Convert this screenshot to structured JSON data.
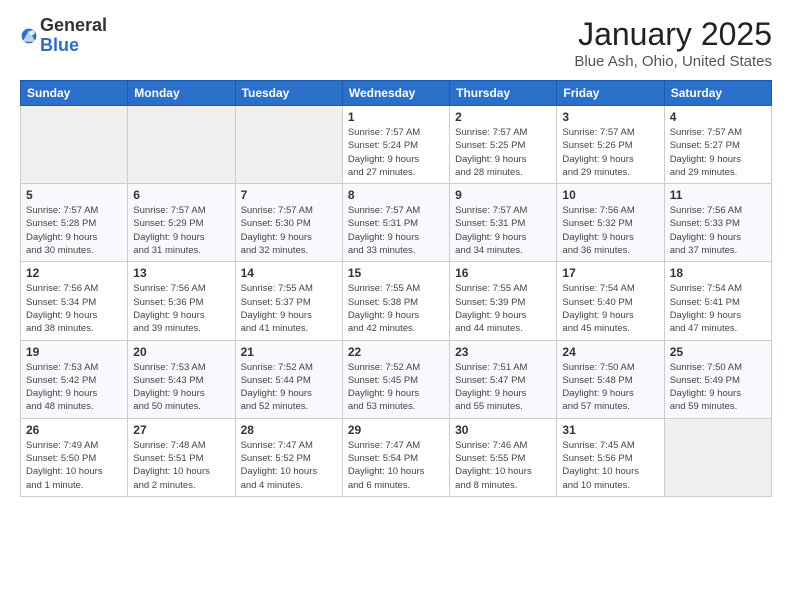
{
  "logo": {
    "general": "General",
    "blue": "Blue"
  },
  "header": {
    "title": "January 2025",
    "subtitle": "Blue Ash, Ohio, United States"
  },
  "weekdays": [
    "Sunday",
    "Monday",
    "Tuesday",
    "Wednesday",
    "Thursday",
    "Friday",
    "Saturday"
  ],
  "weeks": [
    [
      {
        "day": "",
        "info": ""
      },
      {
        "day": "",
        "info": ""
      },
      {
        "day": "",
        "info": ""
      },
      {
        "day": "1",
        "info": "Sunrise: 7:57 AM\nSunset: 5:24 PM\nDaylight: 9 hours\nand 27 minutes."
      },
      {
        "day": "2",
        "info": "Sunrise: 7:57 AM\nSunset: 5:25 PM\nDaylight: 9 hours\nand 28 minutes."
      },
      {
        "day": "3",
        "info": "Sunrise: 7:57 AM\nSunset: 5:26 PM\nDaylight: 9 hours\nand 29 minutes."
      },
      {
        "day": "4",
        "info": "Sunrise: 7:57 AM\nSunset: 5:27 PM\nDaylight: 9 hours\nand 29 minutes."
      }
    ],
    [
      {
        "day": "5",
        "info": "Sunrise: 7:57 AM\nSunset: 5:28 PM\nDaylight: 9 hours\nand 30 minutes."
      },
      {
        "day": "6",
        "info": "Sunrise: 7:57 AM\nSunset: 5:29 PM\nDaylight: 9 hours\nand 31 minutes."
      },
      {
        "day": "7",
        "info": "Sunrise: 7:57 AM\nSunset: 5:30 PM\nDaylight: 9 hours\nand 32 minutes."
      },
      {
        "day": "8",
        "info": "Sunrise: 7:57 AM\nSunset: 5:31 PM\nDaylight: 9 hours\nand 33 minutes."
      },
      {
        "day": "9",
        "info": "Sunrise: 7:57 AM\nSunset: 5:31 PM\nDaylight: 9 hours\nand 34 minutes."
      },
      {
        "day": "10",
        "info": "Sunrise: 7:56 AM\nSunset: 5:32 PM\nDaylight: 9 hours\nand 36 minutes."
      },
      {
        "day": "11",
        "info": "Sunrise: 7:56 AM\nSunset: 5:33 PM\nDaylight: 9 hours\nand 37 minutes."
      }
    ],
    [
      {
        "day": "12",
        "info": "Sunrise: 7:56 AM\nSunset: 5:34 PM\nDaylight: 9 hours\nand 38 minutes."
      },
      {
        "day": "13",
        "info": "Sunrise: 7:56 AM\nSunset: 5:36 PM\nDaylight: 9 hours\nand 39 minutes."
      },
      {
        "day": "14",
        "info": "Sunrise: 7:55 AM\nSunset: 5:37 PM\nDaylight: 9 hours\nand 41 minutes."
      },
      {
        "day": "15",
        "info": "Sunrise: 7:55 AM\nSunset: 5:38 PM\nDaylight: 9 hours\nand 42 minutes."
      },
      {
        "day": "16",
        "info": "Sunrise: 7:55 AM\nSunset: 5:39 PM\nDaylight: 9 hours\nand 44 minutes."
      },
      {
        "day": "17",
        "info": "Sunrise: 7:54 AM\nSunset: 5:40 PM\nDaylight: 9 hours\nand 45 minutes."
      },
      {
        "day": "18",
        "info": "Sunrise: 7:54 AM\nSunset: 5:41 PM\nDaylight: 9 hours\nand 47 minutes."
      }
    ],
    [
      {
        "day": "19",
        "info": "Sunrise: 7:53 AM\nSunset: 5:42 PM\nDaylight: 9 hours\nand 48 minutes."
      },
      {
        "day": "20",
        "info": "Sunrise: 7:53 AM\nSunset: 5:43 PM\nDaylight: 9 hours\nand 50 minutes."
      },
      {
        "day": "21",
        "info": "Sunrise: 7:52 AM\nSunset: 5:44 PM\nDaylight: 9 hours\nand 52 minutes."
      },
      {
        "day": "22",
        "info": "Sunrise: 7:52 AM\nSunset: 5:45 PM\nDaylight: 9 hours\nand 53 minutes."
      },
      {
        "day": "23",
        "info": "Sunrise: 7:51 AM\nSunset: 5:47 PM\nDaylight: 9 hours\nand 55 minutes."
      },
      {
        "day": "24",
        "info": "Sunrise: 7:50 AM\nSunset: 5:48 PM\nDaylight: 9 hours\nand 57 minutes."
      },
      {
        "day": "25",
        "info": "Sunrise: 7:50 AM\nSunset: 5:49 PM\nDaylight: 9 hours\nand 59 minutes."
      }
    ],
    [
      {
        "day": "26",
        "info": "Sunrise: 7:49 AM\nSunset: 5:50 PM\nDaylight: 10 hours\nand 1 minute."
      },
      {
        "day": "27",
        "info": "Sunrise: 7:48 AM\nSunset: 5:51 PM\nDaylight: 10 hours\nand 2 minutes."
      },
      {
        "day": "28",
        "info": "Sunrise: 7:47 AM\nSunset: 5:52 PM\nDaylight: 10 hours\nand 4 minutes."
      },
      {
        "day": "29",
        "info": "Sunrise: 7:47 AM\nSunset: 5:54 PM\nDaylight: 10 hours\nand 6 minutes."
      },
      {
        "day": "30",
        "info": "Sunrise: 7:46 AM\nSunset: 5:55 PM\nDaylight: 10 hours\nand 8 minutes."
      },
      {
        "day": "31",
        "info": "Sunrise: 7:45 AM\nSunset: 5:56 PM\nDaylight: 10 hours\nand 10 minutes."
      },
      {
        "day": "",
        "info": ""
      }
    ]
  ]
}
